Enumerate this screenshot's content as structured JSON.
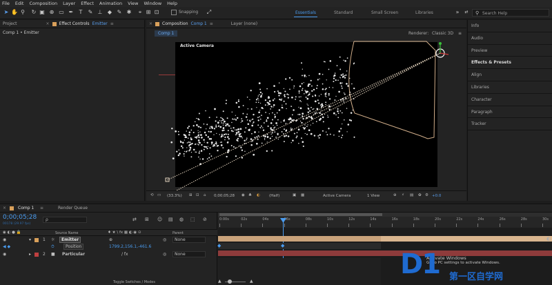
{
  "menubar": {
    "items": [
      "File",
      "Edit",
      "Composition",
      "Layer",
      "Effect",
      "Animation",
      "View",
      "Window",
      "Help"
    ]
  },
  "toolbar": {
    "snapping_label": "Snapping",
    "workspaces": [
      "Essentials",
      "Standard",
      "Small Screen",
      "Libraries"
    ],
    "active_workspace": "Essentials",
    "search_placeholder": "Search Help"
  },
  "left_panel": {
    "tab_project": "Project",
    "tab_effect_controls": "Effect Controls",
    "effect_controls_target": "Emitter",
    "breadcrumb": "Comp 1 • Emitter"
  },
  "composition_panel": {
    "tab_label": "Composition",
    "tab_comp_name": "Comp 1",
    "tab_layer": "Layer (none)",
    "subtab": "Comp 1",
    "renderer_label": "Renderer:",
    "renderer_value": "Classic 3D",
    "viewport_label": "Active Camera",
    "footer": {
      "zoom": "(33.3%)",
      "timecode": "0;00;05;28",
      "resolution": "(Half)",
      "view": "Active Camera",
      "views_count": "1 View",
      "exposure": "+0.0"
    }
  },
  "right_panel": {
    "items": [
      "Info",
      "Audio",
      "Preview",
      "Effects & Presets",
      "Align",
      "Libraries",
      "Character",
      "Paragraph",
      "Tracker"
    ],
    "bold_item": "Effects & Presets"
  },
  "timeline": {
    "tab_label": "Comp 1",
    "render_queue": "Render Queue",
    "timecode": "0;00;05;28",
    "frame_info": "00178 (29.97 fps)",
    "search_placeholder": "ρ",
    "col_source_name": "Source Name",
    "col_parent": "Parent",
    "ruler_marks": [
      "0:00s",
      "02s",
      "04s",
      "06s",
      "08s",
      "10s",
      "12s",
      "14s",
      "16s",
      "18s",
      "20s",
      "22s",
      "24s",
      "26s",
      "28s",
      "30s"
    ],
    "layers": [
      {
        "num": "1",
        "name": "Emitter",
        "parent": "None",
        "color": "#d9a05a"
      },
      {
        "num": "2",
        "name": "Particular",
        "parent": "None",
        "color": "#c04040"
      }
    ],
    "property": {
      "name": "Position",
      "value": "1799.2,156.1,-461.6"
    },
    "footer_label": "Toggle Switches / Modes"
  },
  "watermark": {
    "activate_line1": "Activate Windows",
    "activate_line2": "Go to PC settings to activate Windows.",
    "brand": "D1",
    "brand_cn": "第一区自学网"
  },
  "colors": {
    "accent_blue": "#4a9cf0",
    "layer_bar_emitter": "#d9b58e",
    "layer_bar_particular": "#8e3b3b",
    "camera_wireframe": "#d4b08c",
    "watermark_blue": "#1f6bd1"
  }
}
